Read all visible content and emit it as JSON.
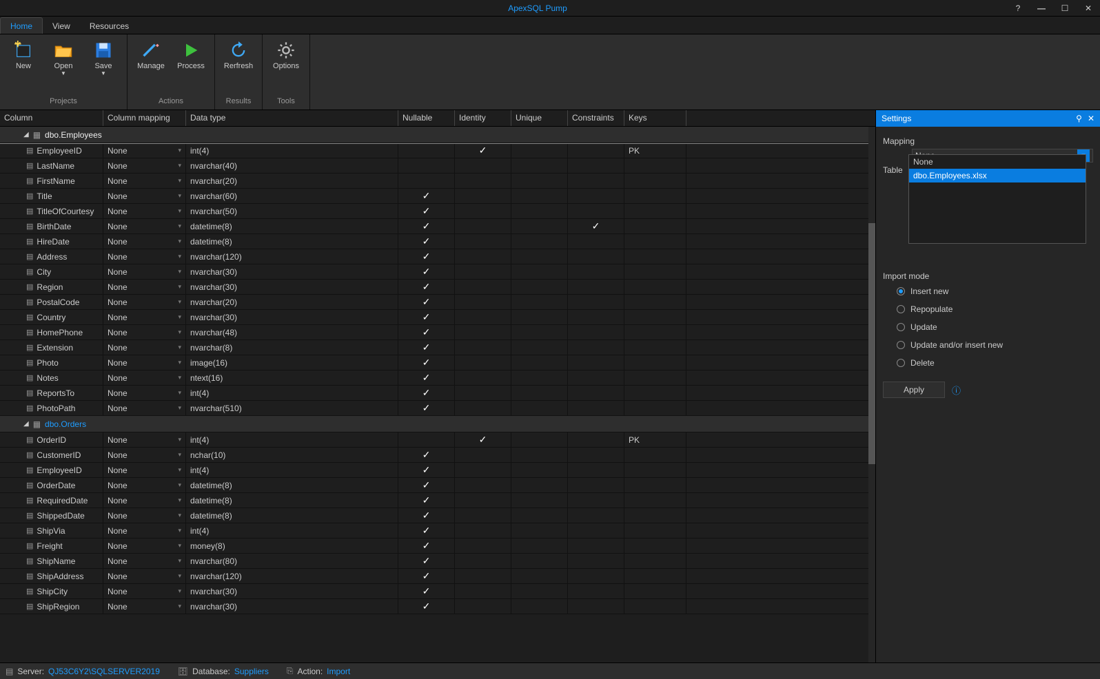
{
  "title": "ApexSQL Pump",
  "tabs": [
    "Home",
    "View",
    "Resources"
  ],
  "ribbon": {
    "groups": [
      {
        "label": "Projects",
        "btns": [
          {
            "id": "new",
            "label": "New",
            "dd": false
          },
          {
            "id": "open",
            "label": "Open",
            "dd": true
          },
          {
            "id": "save",
            "label": "Save",
            "dd": true
          }
        ]
      },
      {
        "label": "Actions",
        "btns": [
          {
            "id": "manage",
            "label": "Manage",
            "dd": false
          },
          {
            "id": "process",
            "label": "Process",
            "dd": false
          }
        ]
      },
      {
        "label": "Results",
        "btns": [
          {
            "id": "refresh",
            "label": "Rerfresh",
            "dd": false
          }
        ]
      },
      {
        "label": "Tools",
        "btns": [
          {
            "id": "options",
            "label": "Options",
            "dd": false
          }
        ]
      }
    ]
  },
  "headers": [
    "Column",
    "Column mapping",
    "Data type",
    "Nullable",
    "Identity",
    "Unique",
    "Constraints",
    "Keys"
  ],
  "tables": [
    {
      "name": "dbo.Employees",
      "selected": true,
      "cols": [
        {
          "n": "EmployeeID",
          "m": "None",
          "t": "int(4)",
          "nul": false,
          "id": true,
          "u": false,
          "c": false,
          "k": "PK"
        },
        {
          "n": "LastName",
          "m": "None",
          "t": "nvarchar(40)",
          "nul": false,
          "id": false,
          "u": false,
          "c": false,
          "k": ""
        },
        {
          "n": "FirstName",
          "m": "None",
          "t": "nvarchar(20)",
          "nul": false,
          "id": false,
          "u": false,
          "c": false,
          "k": ""
        },
        {
          "n": "Title",
          "m": "None",
          "t": "nvarchar(60)",
          "nul": true,
          "id": false,
          "u": false,
          "c": false,
          "k": ""
        },
        {
          "n": "TitleOfCourtesy",
          "m": "None",
          "t": "nvarchar(50)",
          "nul": true,
          "id": false,
          "u": false,
          "c": false,
          "k": ""
        },
        {
          "n": "BirthDate",
          "m": "None",
          "t": "datetime(8)",
          "nul": true,
          "id": false,
          "u": false,
          "c": true,
          "k": ""
        },
        {
          "n": "HireDate",
          "m": "None",
          "t": "datetime(8)",
          "nul": true,
          "id": false,
          "u": false,
          "c": false,
          "k": ""
        },
        {
          "n": "Address",
          "m": "None",
          "t": "nvarchar(120)",
          "nul": true,
          "id": false,
          "u": false,
          "c": false,
          "k": ""
        },
        {
          "n": "City",
          "m": "None",
          "t": "nvarchar(30)",
          "nul": true,
          "id": false,
          "u": false,
          "c": false,
          "k": ""
        },
        {
          "n": "Region",
          "m": "None",
          "t": "nvarchar(30)",
          "nul": true,
          "id": false,
          "u": false,
          "c": false,
          "k": ""
        },
        {
          "n": "PostalCode",
          "m": "None",
          "t": "nvarchar(20)",
          "nul": true,
          "id": false,
          "u": false,
          "c": false,
          "k": ""
        },
        {
          "n": "Country",
          "m": "None",
          "t": "nvarchar(30)",
          "nul": true,
          "id": false,
          "u": false,
          "c": false,
          "k": ""
        },
        {
          "n": "HomePhone",
          "m": "None",
          "t": "nvarchar(48)",
          "nul": true,
          "id": false,
          "u": false,
          "c": false,
          "k": ""
        },
        {
          "n": "Extension",
          "m": "None",
          "t": "nvarchar(8)",
          "nul": true,
          "id": false,
          "u": false,
          "c": false,
          "k": ""
        },
        {
          "n": "Photo",
          "m": "None",
          "t": "image(16)",
          "nul": true,
          "id": false,
          "u": false,
          "c": false,
          "k": ""
        },
        {
          "n": "Notes",
          "m": "None",
          "t": "ntext(16)",
          "nul": true,
          "id": false,
          "u": false,
          "c": false,
          "k": ""
        },
        {
          "n": "ReportsTo",
          "m": "None",
          "t": "int(4)",
          "nul": true,
          "id": false,
          "u": false,
          "c": false,
          "k": ""
        },
        {
          "n": "PhotoPath",
          "m": "None",
          "t": "nvarchar(510)",
          "nul": true,
          "id": false,
          "u": false,
          "c": false,
          "k": ""
        }
      ]
    },
    {
      "name": "dbo.Orders",
      "selected": false,
      "cols": [
        {
          "n": "OrderID",
          "m": "None",
          "t": "int(4)",
          "nul": false,
          "id": true,
          "u": false,
          "c": false,
          "k": "PK"
        },
        {
          "n": "CustomerID",
          "m": "None",
          "t": "nchar(10)",
          "nul": true,
          "id": false,
          "u": false,
          "c": false,
          "k": ""
        },
        {
          "n": "EmployeeID",
          "m": "None",
          "t": "int(4)",
          "nul": true,
          "id": false,
          "u": false,
          "c": false,
          "k": ""
        },
        {
          "n": "OrderDate",
          "m": "None",
          "t": "datetime(8)",
          "nul": true,
          "id": false,
          "u": false,
          "c": false,
          "k": ""
        },
        {
          "n": "RequiredDate",
          "m": "None",
          "t": "datetime(8)",
          "nul": true,
          "id": false,
          "u": false,
          "c": false,
          "k": ""
        },
        {
          "n": "ShippedDate",
          "m": "None",
          "t": "datetime(8)",
          "nul": true,
          "id": false,
          "u": false,
          "c": false,
          "k": ""
        },
        {
          "n": "ShipVia",
          "m": "None",
          "t": "int(4)",
          "nul": true,
          "id": false,
          "u": false,
          "c": false,
          "k": ""
        },
        {
          "n": "Freight",
          "m": "None",
          "t": "money(8)",
          "nul": true,
          "id": false,
          "u": false,
          "c": false,
          "k": ""
        },
        {
          "n": "ShipName",
          "m": "None",
          "t": "nvarchar(80)",
          "nul": true,
          "id": false,
          "u": false,
          "c": false,
          "k": ""
        },
        {
          "n": "ShipAddress",
          "m": "None",
          "t": "nvarchar(120)",
          "nul": true,
          "id": false,
          "u": false,
          "c": false,
          "k": ""
        },
        {
          "n": "ShipCity",
          "m": "None",
          "t": "nvarchar(30)",
          "nul": true,
          "id": false,
          "u": false,
          "c": false,
          "k": ""
        },
        {
          "n": "ShipRegion",
          "m": "None",
          "t": "nvarchar(30)",
          "nul": true,
          "id": false,
          "u": false,
          "c": false,
          "k": ""
        }
      ]
    }
  ],
  "settings": {
    "title": "Settings",
    "mapping_label": "Mapping",
    "table_label": "Table",
    "combo_value": "None",
    "options": [
      "None",
      "dbo.Employees.xlsx"
    ],
    "import_mode_label": "Import mode",
    "modes": [
      "Insert new",
      "Repopulate",
      "Update",
      "Update and/or insert new",
      "Delete"
    ],
    "selected_mode": 0,
    "apply": "Apply"
  },
  "status": {
    "server_k": "Server:",
    "server_v": "QJ53C6Y2\\SQLSERVER2019",
    "db_k": "Database:",
    "db_v": "Suppliers",
    "act_k": "Action:",
    "act_v": "Import"
  }
}
